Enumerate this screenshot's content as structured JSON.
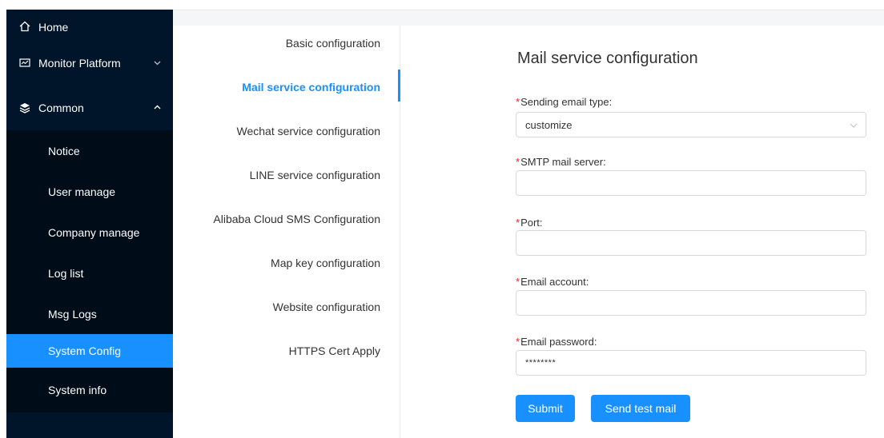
{
  "sidebar": {
    "home_label": "Home",
    "monitor_label": "Monitor Platform",
    "common_label": "Common",
    "items": [
      {
        "label": "Notice"
      },
      {
        "label": "User manage"
      },
      {
        "label": "Company manage"
      },
      {
        "label": "Log list"
      },
      {
        "label": "Msg Logs"
      },
      {
        "label": "System Config"
      },
      {
        "label": "System info"
      }
    ],
    "active_item": "System Config"
  },
  "config_nav": {
    "items": [
      {
        "label": "Basic configuration"
      },
      {
        "label": "Mail service configuration"
      },
      {
        "label": "Wechat service configuration"
      },
      {
        "label": "LINE service configuration"
      },
      {
        "label": "Alibaba Cloud SMS Configuration"
      },
      {
        "label": "Map key configuration"
      },
      {
        "label": "Website configuration"
      },
      {
        "label": "HTTPS Cert Apply"
      }
    ],
    "active_item": "Mail service configuration"
  },
  "form": {
    "title": "Mail service configuration",
    "required_mark": "*",
    "fields": [
      {
        "label": "Sending email type:",
        "value": "customize"
      },
      {
        "label": "SMTP mail server:",
        "value": ""
      },
      {
        "label": "Port:",
        "value": ""
      },
      {
        "label": "Email account:",
        "value": ""
      },
      {
        "label": "Email password:",
        "value": "********"
      }
    ],
    "submit_label": "Submit",
    "test_label": "Send test mail"
  },
  "colors": {
    "sidebar_bg": "#001529",
    "submenu_bg": "#000c17",
    "accent": "#1890ff",
    "required": "#f5222d"
  }
}
